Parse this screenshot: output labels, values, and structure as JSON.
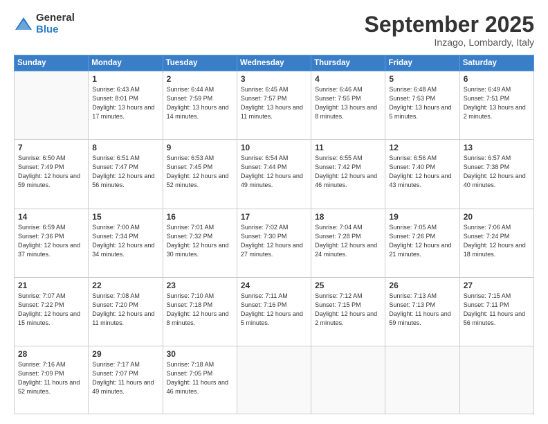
{
  "logo": {
    "general": "General",
    "blue": "Blue"
  },
  "header": {
    "month": "September 2025",
    "location": "Inzago, Lombardy, Italy"
  },
  "weekdays": [
    "Sunday",
    "Monday",
    "Tuesday",
    "Wednesday",
    "Thursday",
    "Friday",
    "Saturday"
  ],
  "days": [
    {
      "date": "",
      "info": ""
    },
    {
      "date": "1",
      "info": "Sunrise: 6:43 AM\nSunset: 8:01 PM\nDaylight: 13 hours\nand 17 minutes."
    },
    {
      "date": "2",
      "info": "Sunrise: 6:44 AM\nSunset: 7:59 PM\nDaylight: 13 hours\nand 14 minutes."
    },
    {
      "date": "3",
      "info": "Sunrise: 6:45 AM\nSunset: 7:57 PM\nDaylight: 13 hours\nand 11 minutes."
    },
    {
      "date": "4",
      "info": "Sunrise: 6:46 AM\nSunset: 7:55 PM\nDaylight: 13 hours\nand 8 minutes."
    },
    {
      "date": "5",
      "info": "Sunrise: 6:48 AM\nSunset: 7:53 PM\nDaylight: 13 hours\nand 5 minutes."
    },
    {
      "date": "6",
      "info": "Sunrise: 6:49 AM\nSunset: 7:51 PM\nDaylight: 13 hours\nand 2 minutes."
    },
    {
      "date": "7",
      "info": "Sunrise: 6:50 AM\nSunset: 7:49 PM\nDaylight: 12 hours\nand 59 minutes."
    },
    {
      "date": "8",
      "info": "Sunrise: 6:51 AM\nSunset: 7:47 PM\nDaylight: 12 hours\nand 56 minutes."
    },
    {
      "date": "9",
      "info": "Sunrise: 6:53 AM\nSunset: 7:45 PM\nDaylight: 12 hours\nand 52 minutes."
    },
    {
      "date": "10",
      "info": "Sunrise: 6:54 AM\nSunset: 7:44 PM\nDaylight: 12 hours\nand 49 minutes."
    },
    {
      "date": "11",
      "info": "Sunrise: 6:55 AM\nSunset: 7:42 PM\nDaylight: 12 hours\nand 46 minutes."
    },
    {
      "date": "12",
      "info": "Sunrise: 6:56 AM\nSunset: 7:40 PM\nDaylight: 12 hours\nand 43 minutes."
    },
    {
      "date": "13",
      "info": "Sunrise: 6:57 AM\nSunset: 7:38 PM\nDaylight: 12 hours\nand 40 minutes."
    },
    {
      "date": "14",
      "info": "Sunrise: 6:59 AM\nSunset: 7:36 PM\nDaylight: 12 hours\nand 37 minutes."
    },
    {
      "date": "15",
      "info": "Sunrise: 7:00 AM\nSunset: 7:34 PM\nDaylight: 12 hours\nand 34 minutes."
    },
    {
      "date": "16",
      "info": "Sunrise: 7:01 AM\nSunset: 7:32 PM\nDaylight: 12 hours\nand 30 minutes."
    },
    {
      "date": "17",
      "info": "Sunrise: 7:02 AM\nSunset: 7:30 PM\nDaylight: 12 hours\nand 27 minutes."
    },
    {
      "date": "18",
      "info": "Sunrise: 7:04 AM\nSunset: 7:28 PM\nDaylight: 12 hours\nand 24 minutes."
    },
    {
      "date": "19",
      "info": "Sunrise: 7:05 AM\nSunset: 7:26 PM\nDaylight: 12 hours\nand 21 minutes."
    },
    {
      "date": "20",
      "info": "Sunrise: 7:06 AM\nSunset: 7:24 PM\nDaylight: 12 hours\nand 18 minutes."
    },
    {
      "date": "21",
      "info": "Sunrise: 7:07 AM\nSunset: 7:22 PM\nDaylight: 12 hours\nand 15 minutes."
    },
    {
      "date": "22",
      "info": "Sunrise: 7:08 AM\nSunset: 7:20 PM\nDaylight: 12 hours\nand 11 minutes."
    },
    {
      "date": "23",
      "info": "Sunrise: 7:10 AM\nSunset: 7:18 PM\nDaylight: 12 hours\nand 8 minutes."
    },
    {
      "date": "24",
      "info": "Sunrise: 7:11 AM\nSunset: 7:16 PM\nDaylight: 12 hours\nand 5 minutes."
    },
    {
      "date": "25",
      "info": "Sunrise: 7:12 AM\nSunset: 7:15 PM\nDaylight: 12 hours\nand 2 minutes."
    },
    {
      "date": "26",
      "info": "Sunrise: 7:13 AM\nSunset: 7:13 PM\nDaylight: 11 hours\nand 59 minutes."
    },
    {
      "date": "27",
      "info": "Sunrise: 7:15 AM\nSunset: 7:11 PM\nDaylight: 11 hours\nand 56 minutes."
    },
    {
      "date": "28",
      "info": "Sunrise: 7:16 AM\nSunset: 7:09 PM\nDaylight: 11 hours\nand 52 minutes."
    },
    {
      "date": "29",
      "info": "Sunrise: 7:17 AM\nSunset: 7:07 PM\nDaylight: 11 hours\nand 49 minutes."
    },
    {
      "date": "30",
      "info": "Sunrise: 7:18 AM\nSunset: 7:05 PM\nDaylight: 11 hours\nand 46 minutes."
    },
    {
      "date": "",
      "info": ""
    },
    {
      "date": "",
      "info": ""
    },
    {
      "date": "",
      "info": ""
    },
    {
      "date": "",
      "info": ""
    }
  ]
}
